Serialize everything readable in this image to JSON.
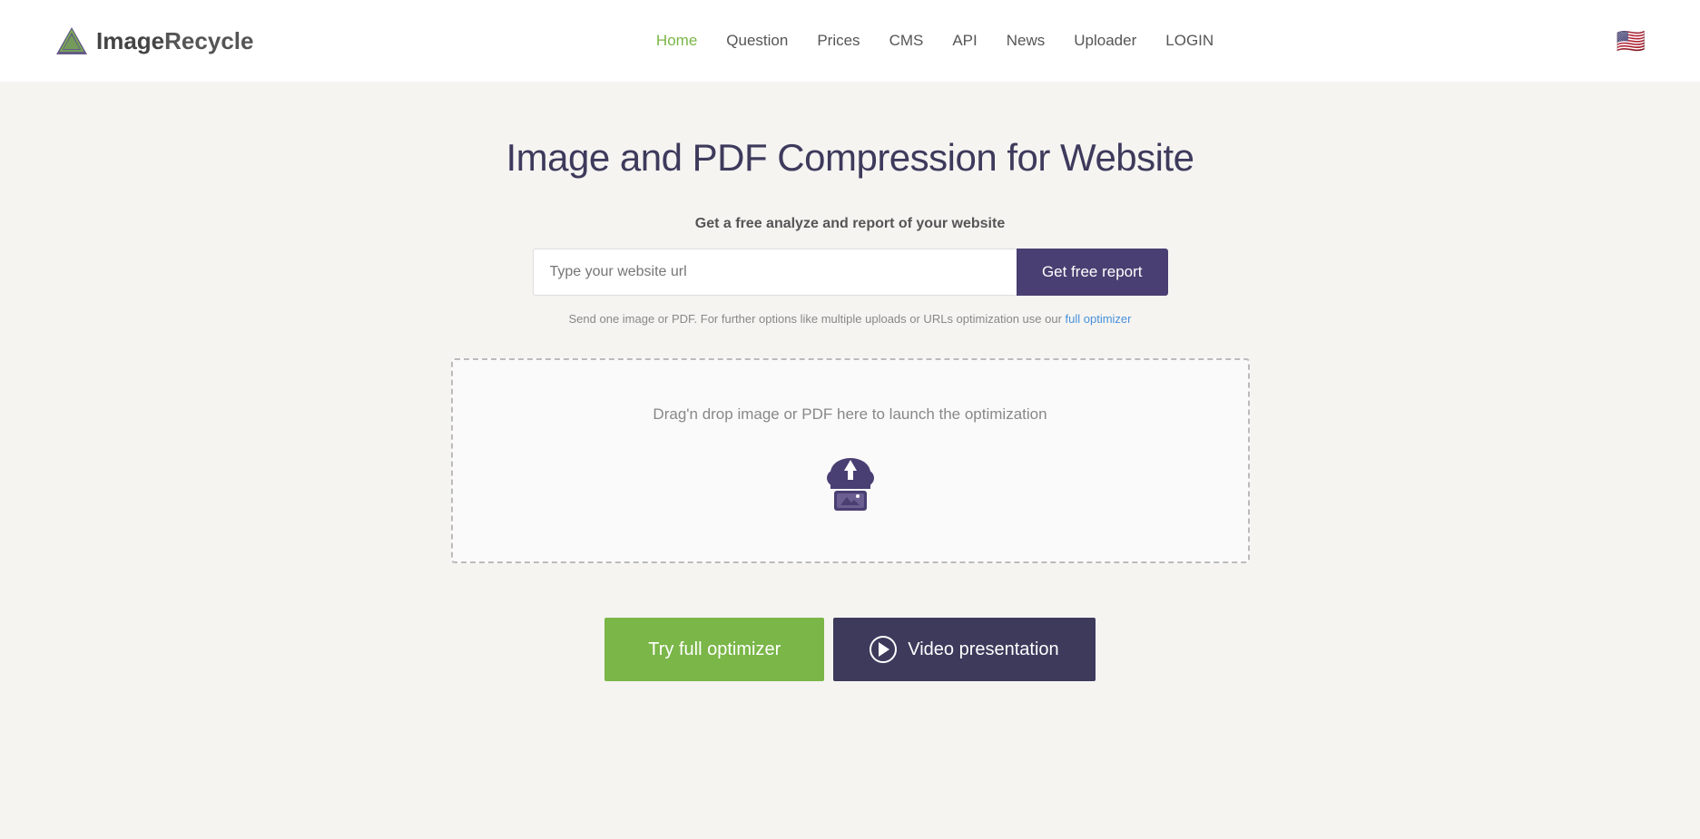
{
  "header": {
    "logo_image": "image-recycle",
    "logo_text_first": "Image",
    "logo_text_second": "Recycle",
    "nav": {
      "items": [
        {
          "label": "Home",
          "active": true
        },
        {
          "label": "Question",
          "active": false
        },
        {
          "label": "Prices",
          "active": false
        },
        {
          "label": "CMS",
          "active": false
        },
        {
          "label": "API",
          "active": false
        },
        {
          "label": "News",
          "active": false
        },
        {
          "label": "Uploader",
          "active": false
        },
        {
          "label": "LOGIN",
          "active": false
        }
      ]
    },
    "flag_icon": "🇺🇸"
  },
  "main": {
    "hero_title": "Image and PDF Compression for Website",
    "subtitle": "Get a free analyze and report of your website",
    "url_input_placeholder": "Type your website url",
    "get_report_button": "Get free report",
    "helper_text_before": "Send one image or PDF. For further options like multiple uploads or URLs optimization use our ",
    "helper_link_text": "full optimizer",
    "helper_text_after": "",
    "drop_zone_text": "Drag'n drop image or PDF here to launch the optimization",
    "btn_optimizer": "Try full optimizer",
    "btn_video": "Video presentation"
  }
}
